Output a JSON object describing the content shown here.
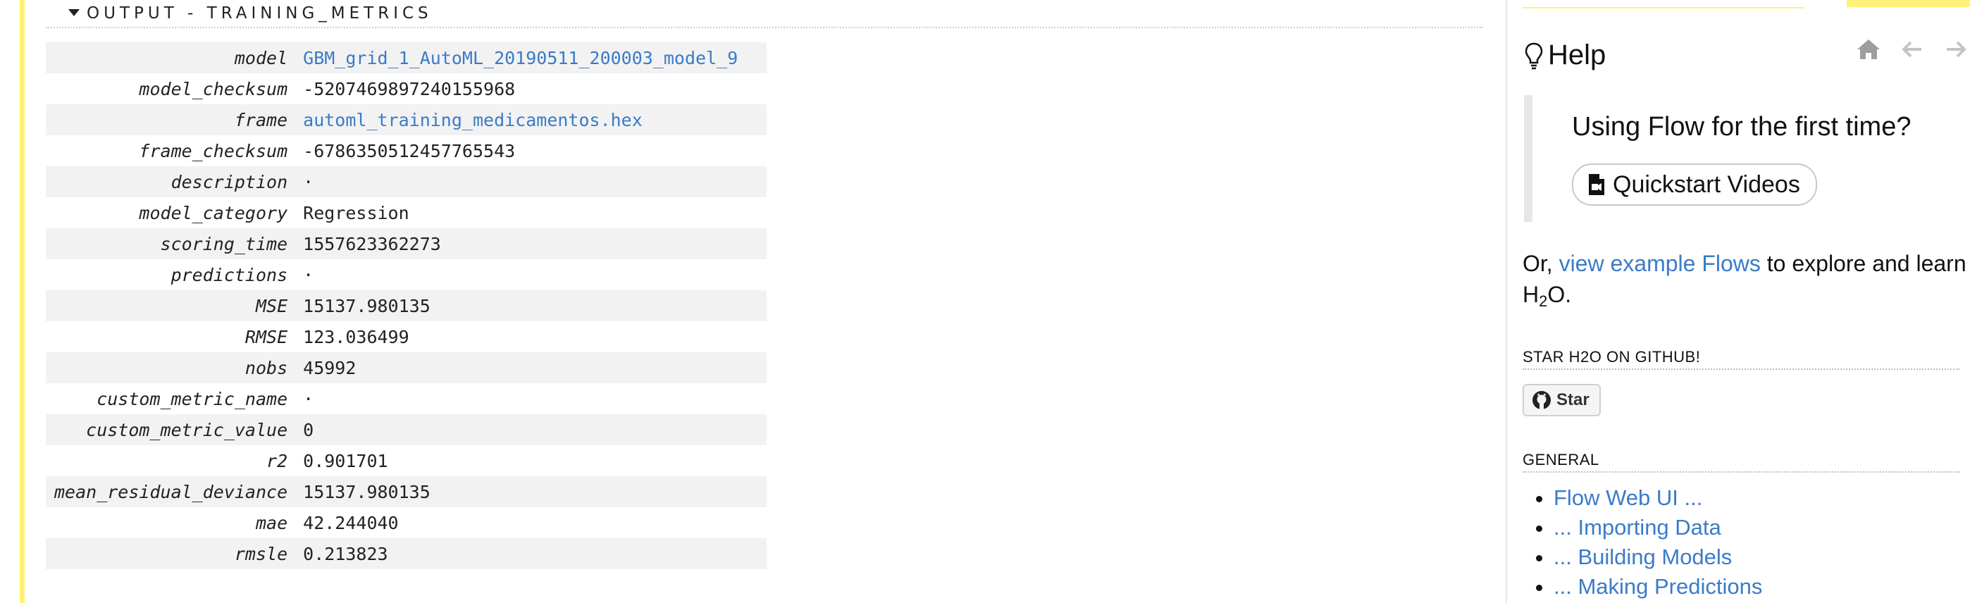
{
  "section": {
    "title": "OUTPUT - TRAINING_METRICS"
  },
  "metrics": [
    {
      "key": "model",
      "value": "GBM_grid_1_AutoML_20190511_200003_model_9",
      "link": true
    },
    {
      "key": "model_checksum",
      "value": "-5207469897240155968",
      "link": false
    },
    {
      "key": "frame",
      "value": "automl_training_medicamentos.hex",
      "link": true
    },
    {
      "key": "frame_checksum",
      "value": "-6786350512457765543",
      "link": false
    },
    {
      "key": "description",
      "value": "·",
      "link": false
    },
    {
      "key": "model_category",
      "value": "Regression",
      "link": false
    },
    {
      "key": "scoring_time",
      "value": "1557623362273",
      "link": false
    },
    {
      "key": "predictions",
      "value": "·",
      "link": false
    },
    {
      "key": "MSE",
      "value": "15137.980135",
      "link": false
    },
    {
      "key": "RMSE",
      "value": "123.036499",
      "link": false
    },
    {
      "key": "nobs",
      "value": "45992",
      "link": false
    },
    {
      "key": "custom_metric_name",
      "value": "·",
      "link": false
    },
    {
      "key": "custom_metric_value",
      "value": "0",
      "link": false
    },
    {
      "key": "r2",
      "value": "0.901701",
      "link": false
    },
    {
      "key": "mean_residual_deviance",
      "value": "15137.980135",
      "link": false
    },
    {
      "key": "mae",
      "value": "42.244040",
      "link": false
    },
    {
      "key": "rmsle",
      "value": "0.213823",
      "link": false
    }
  ],
  "help": {
    "title": "Help",
    "nav_icons": [
      "home-icon",
      "arrow-left-icon",
      "arrow-right-icon"
    ],
    "first_time": "Using Flow for the first time?",
    "quickstart_label": "Quickstart Videos",
    "para_prefix": "Or, ",
    "para_link": "view example Flows",
    "para_suffix": " to explore and learn",
    "h2o_h": "H",
    "h2o_sub": "2",
    "h2o_o": "O.",
    "star_heading": "STAR H2O ON GITHUB!",
    "star_label": "Star",
    "general_heading": "GENERAL",
    "links": [
      "Flow Web UI ...",
      "... Importing Data",
      "... Building Models",
      "... Making Predictions"
    ]
  },
  "colors": {
    "accent_yellow": "#fff176",
    "link_blue": "#3a7bc8"
  }
}
